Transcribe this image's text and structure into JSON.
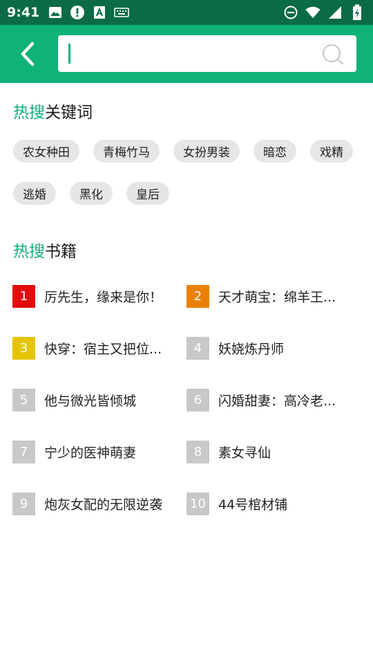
{
  "status_bar": {
    "time": "9:41",
    "left_icons": [
      "image-icon",
      "alert-icon",
      "text-icon",
      "keyboard-icon"
    ],
    "right_icons": [
      "do-not-disturb-icon",
      "wifi-icon",
      "signal-icon",
      "battery-charging-icon"
    ]
  },
  "header": {
    "back_icon": "chevron-left-icon",
    "search": {
      "value": "",
      "placeholder": ""
    },
    "search_icon": "search-icon"
  },
  "hot_keywords": {
    "title_accent": "热搜",
    "title_rest": "关键词",
    "chips": [
      "农女种田",
      "青梅竹马",
      "女扮男装",
      "暗恋",
      "戏精",
      "逃婚",
      "黑化",
      "皇后"
    ]
  },
  "hot_books": {
    "title_accent": "热搜",
    "title_rest": "书籍",
    "items": [
      {
        "rank": "1",
        "title": "厉先生，缘来是你！"
      },
      {
        "rank": "2",
        "title": "天才萌宝：绵羊王..."
      },
      {
        "rank": "3",
        "title": "快穿：宿主又把位..."
      },
      {
        "rank": "4",
        "title": "妖娆炼丹师"
      },
      {
        "rank": "5",
        "title": "他与微光皆倾城"
      },
      {
        "rank": "6",
        "title": "闪婚甜妻：高冷老..."
      },
      {
        "rank": "7",
        "title": "宁少的医神萌妻"
      },
      {
        "rank": "8",
        "title": "素女寻仙"
      },
      {
        "rank": "9",
        "title": "炮灰女配的无限逆袭"
      },
      {
        "rank": "10",
        "title": "44号棺材铺"
      }
    ]
  },
  "colors": {
    "status_bar": "#0a6b45",
    "header": "#0fb277",
    "accent": "#0fb277",
    "rank_1": "#e20d0d",
    "rank_2": "#e98006",
    "rank_3": "#e5c404",
    "rank_other": "#c8c8c8",
    "chip_bg": "#e6e6e6"
  }
}
